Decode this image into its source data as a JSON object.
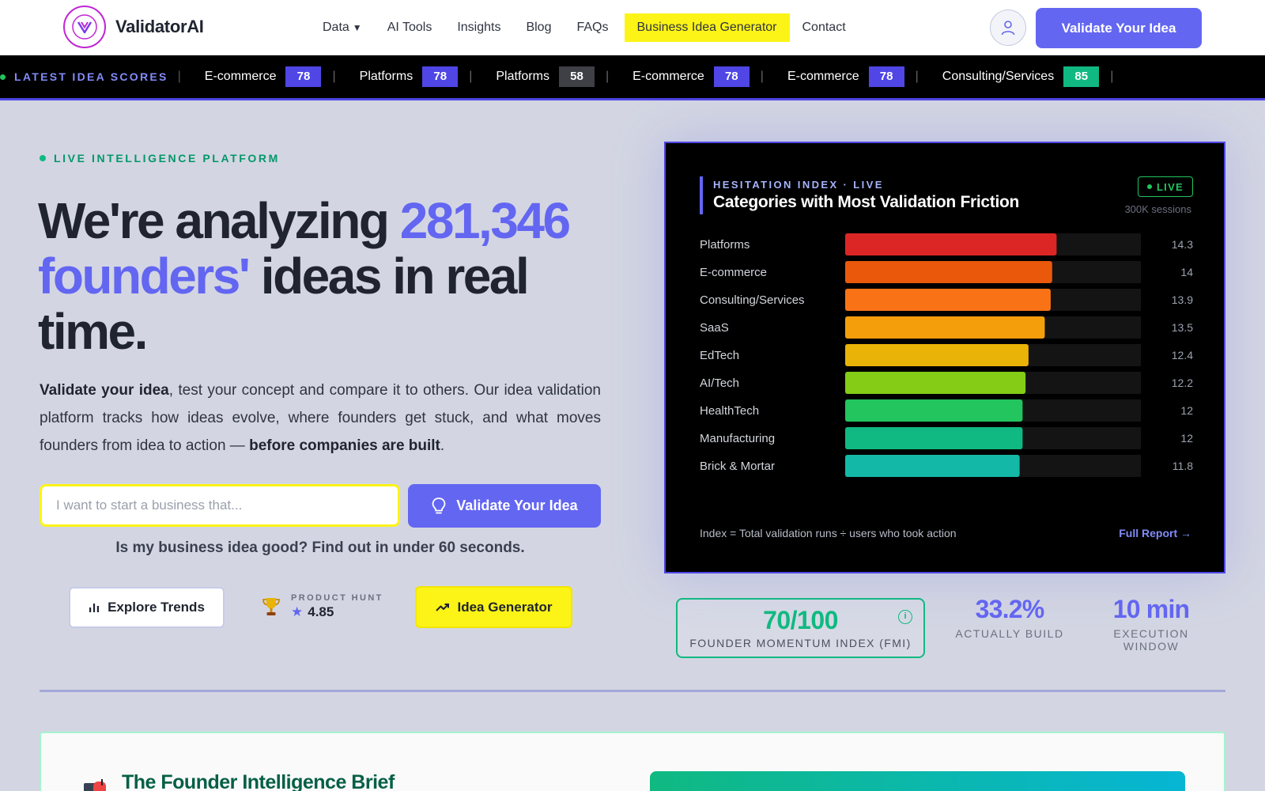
{
  "nav": {
    "brand": "ValidatorAI",
    "links": [
      "Data",
      "AI Tools",
      "Insights",
      "Blog",
      "FAQs",
      "Business Idea Generator",
      "Contact"
    ],
    "data_caret": "▼",
    "cta": "Validate Your Idea"
  },
  "ticker": {
    "label": "LATEST IDEA SCORES",
    "items": [
      {
        "category": "E-commerce",
        "score": "78",
        "color": "#4f46e5"
      },
      {
        "category": "Platforms",
        "score": "78",
        "color": "#4f46e5"
      },
      {
        "category": "Platforms",
        "score": "58",
        "color": "#3f3f46"
      },
      {
        "category": "E-commerce",
        "score": "78",
        "color": "#4f46e5"
      },
      {
        "category": "E-commerce",
        "score": "78",
        "color": "#4f46e5"
      },
      {
        "category": "Consulting/Services",
        "score": "85",
        "color": "#10b981"
      }
    ]
  },
  "hero": {
    "eyebrow": "LIVE INTELLIGENCE PLATFORM",
    "headline_pre": "We're analyzing ",
    "headline_accent": "281,346 founders'",
    "headline_post": " ideas in real time.",
    "lede_bold1": "Validate your idea",
    "lede_mid": ", test your concept and compare it to others. Our idea validation platform tracks how ideas evolve, where founders get stuck, and what moves founders from idea to action — ",
    "lede_bold2": "before companies are built",
    "lede_end": ".",
    "search_placeholder": "I want to start a business that...",
    "validate_label": "Validate Your Idea",
    "subline": "Is my business idea good? Find out in under 60 seconds.",
    "explore_label": "Explore Trends",
    "ph_label": "PRODUCT HUNT",
    "ph_rating": "4.85",
    "idea_gen_label": "Idea Generator"
  },
  "panel": {
    "eyebrow": "HESITATION INDEX · LIVE",
    "title": "Categories with Most Validation Friction",
    "live": "LIVE",
    "sessions": "300K sessions",
    "footnote": "Index = Total validation runs ÷ users who took action",
    "full_report": "Full Report →"
  },
  "chart_data": {
    "type": "bar",
    "orientation": "horizontal",
    "categories": [
      "Platforms",
      "E-commerce",
      "Consulting/Services",
      "SaaS",
      "EdTech",
      "AI/Tech",
      "HealthTech",
      "Manufacturing",
      "Brick & Mortar"
    ],
    "values": [
      14.3,
      14,
      13.9,
      13.5,
      12.4,
      12.2,
      12,
      12,
      11.8
    ],
    "value_labels": [
      "14.3",
      "14",
      "13.9",
      "13.5",
      "12.4",
      "12.2",
      "12",
      "12",
      "11.8"
    ],
    "colors": [
      "#dc2626",
      "#ea580c",
      "#f97316",
      "#f59e0b",
      "#eab308",
      "#84cc16",
      "#22c55e",
      "#10b981",
      "#14b8a6"
    ],
    "xlim": [
      0,
      20
    ],
    "grid": false,
    "legend": false
  },
  "stats": {
    "fmi_value": "70/100",
    "fmi_label": "FOUNDER MOMENTUM INDEX (FMI)",
    "build_value": "33.2%",
    "build_label": "ACTUALLY BUILD",
    "window_value": "10 min",
    "window_label": "EXECUTION WINDOW"
  },
  "brief": {
    "title": "The Founder Intelligence Brief"
  }
}
